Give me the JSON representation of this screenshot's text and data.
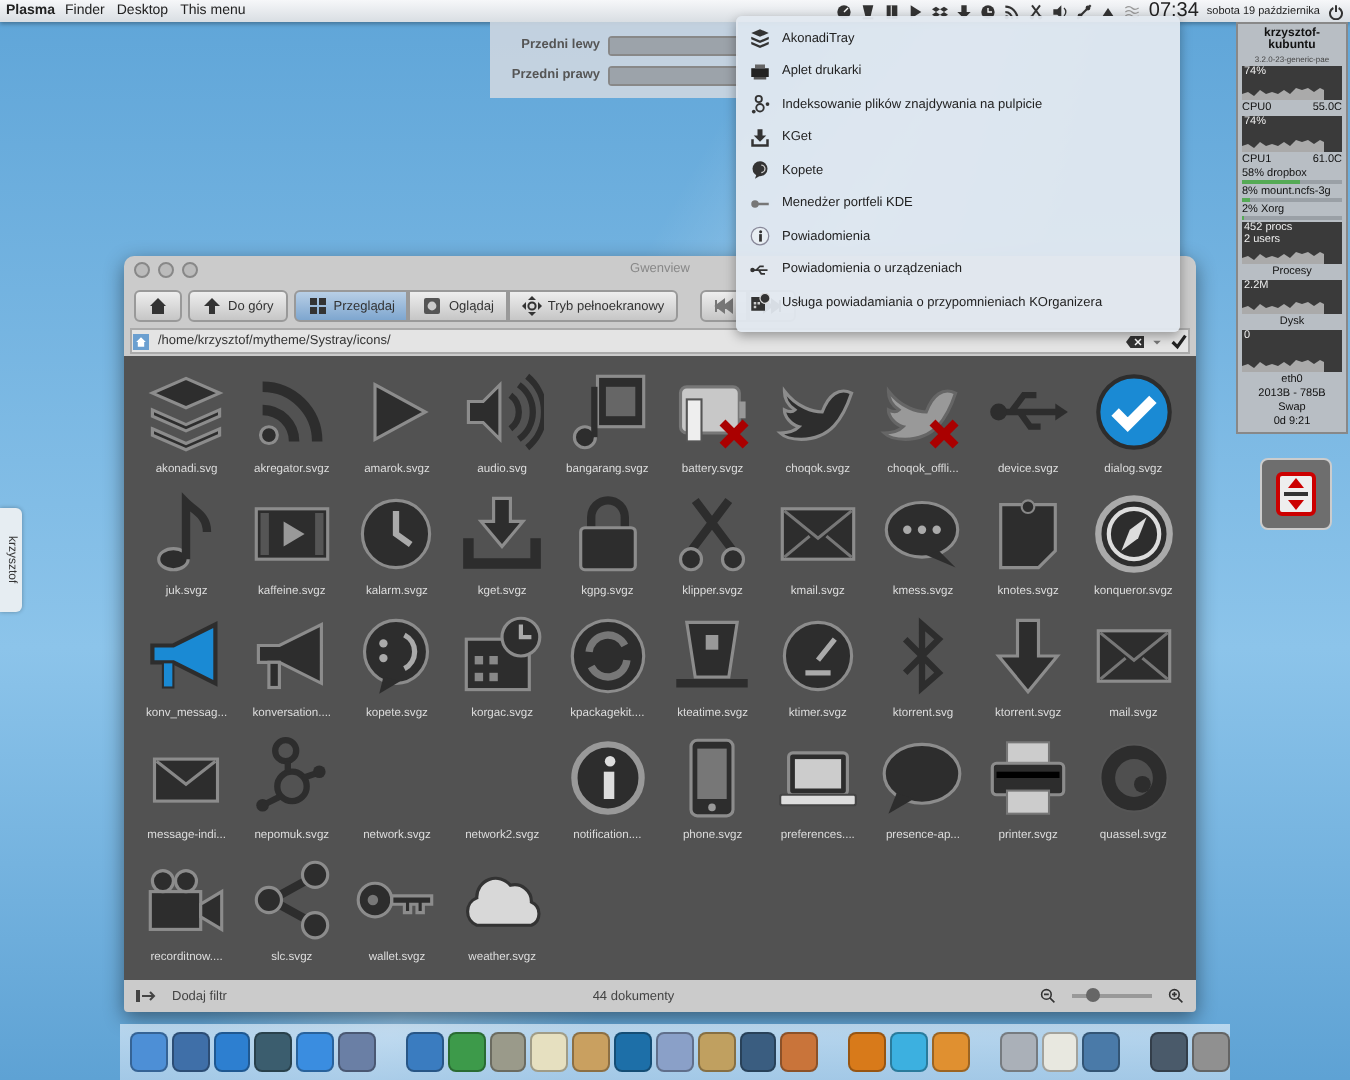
{
  "top_panel": {
    "app_name": "Plasma",
    "menus": [
      "Finder",
      "Desktop",
      "This menu"
    ],
    "clock": "07:34",
    "date": "sobota 19 października"
  },
  "mixer": {
    "channels": [
      {
        "name": "Przedni lewy",
        "level": 1
      },
      {
        "name": "Przedni prawy",
        "level": 1
      }
    ]
  },
  "tray_menu": {
    "items": [
      "AkonadiTray",
      "Aplet drukarki",
      "Indeksowanie plików znajdywania na pulpicie",
      "KGet",
      "Kopete",
      "Menedżer portfeli KDE",
      "Powiadomienia",
      "Powiadomienia o urządzeniach",
      "Usługa powiadamiania o przypomnieniach KOrganizera"
    ]
  },
  "system_monitor": {
    "host": "krzysztof-kubuntu",
    "kernel": "3.2.0-23-generic-pae",
    "cpus": [
      {
        "usage": "74%",
        "name": "CPU0",
        "temp": "55.0C"
      },
      {
        "usage": "74%",
        "name": "CPU1",
        "temp": "61.0C"
      }
    ],
    "processes": [
      {
        "label": "58% dropbox",
        "level": 0.58
      },
      {
        "label": "8% mount.ncfs-3g",
        "level": 0.08
      },
      {
        "label": "2% Xorg",
        "level": 0.02
      }
    ],
    "procs": "452 procs",
    "users": "2 users",
    "processes_title": "Procesy",
    "memory": "2.2M",
    "disk_title": "Dysk",
    "disk": "0",
    "net_name": "eth0",
    "net_rate": "2013B - 785B",
    "swap": "Swap",
    "uptime": "0d 9:21"
  },
  "side_tab": {
    "label": "krzysztof"
  },
  "window": {
    "title": "Gwenview",
    "up_button": "Do góry",
    "modes": [
      {
        "label": "Przeglądaj",
        "selected": true
      },
      {
        "label": "Oglądaj",
        "selected": false
      },
      {
        "label": "Tryb pełnoekranowy",
        "selected": false
      }
    ],
    "path": "/home/krzysztof/mytheme/Systray/icons/",
    "files": [
      "akonadi.svg",
      "akregator.svgz",
      "amarok.svgz",
      "audio.svg",
      "bangarang.svgz",
      "battery.svgz",
      "choqok.svgz",
      "choqok_offli...",
      "device.svgz",
      "dialog.svgz",
      "juk.svgz",
      "kaffeine.svgz",
      "kalarm.svgz",
      "kget.svgz",
      "kgpg.svgz",
      "klipper.svgz",
      "kmail.svgz",
      "kmess.svgz",
      "knotes.svgz",
      "konqueror.svgz",
      "konv_messag...",
      "konversation....",
      "kopete.svgz",
      "korgac.svgz",
      "kpackagekit....",
      "kteatime.svgz",
      "ktimer.svgz",
      "ktorrent.svg",
      "ktorrent.svgz",
      "mail.svgz",
      "message-indi...",
      "nepomuk.svgz",
      "network.svgz",
      "network2.svgz",
      "notification....",
      "phone.svgz",
      "preferences....",
      "presence-ap...",
      "printer.svgz",
      "quassel.svgz",
      "recorditnow....",
      "slc.svgz",
      "wallet.svgz",
      "weather.svgz"
    ],
    "status_bar": {
      "filter_button": "Dodaj filtr",
      "count": "44 dokumenty",
      "zoom": {
        "level": 0.25
      }
    }
  }
}
